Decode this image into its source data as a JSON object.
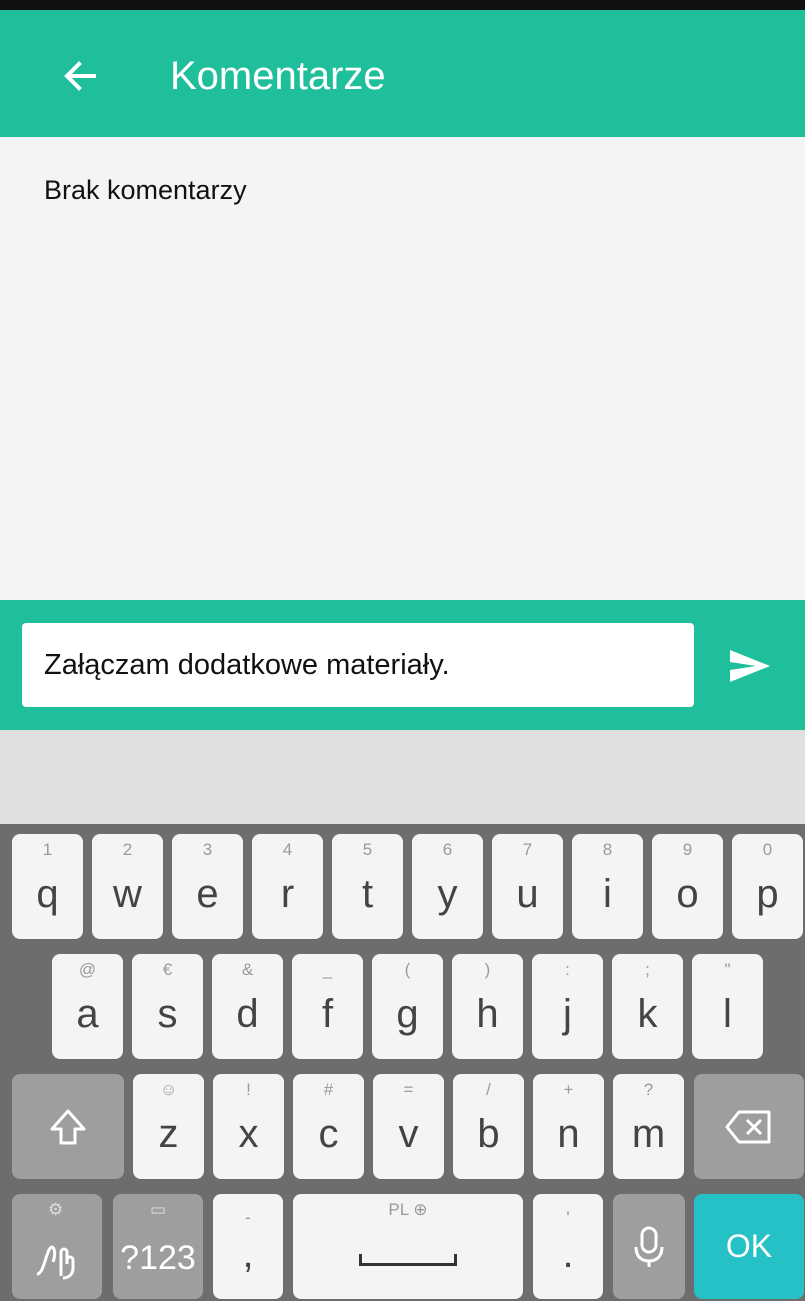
{
  "header": {
    "title": "Komentarze",
    "back_icon": "arrow-left-icon",
    "color": "#1fbf9b"
  },
  "comments": {
    "empty_text": "Brak komentarzy"
  },
  "composer": {
    "value": "Załączam dodatkowe materiały.",
    "send_icon": "send-icon"
  },
  "keyboard": {
    "row1": [
      {
        "hint": "1",
        "char": "q"
      },
      {
        "hint": "2",
        "char": "w"
      },
      {
        "hint": "3",
        "char": "e"
      },
      {
        "hint": "4",
        "char": "r"
      },
      {
        "hint": "5",
        "char": "t"
      },
      {
        "hint": "6",
        "char": "y"
      },
      {
        "hint": "7",
        "char": "u"
      },
      {
        "hint": "8",
        "char": "i"
      },
      {
        "hint": "9",
        "char": "o"
      },
      {
        "hint": "0",
        "char": "p"
      }
    ],
    "row2": [
      {
        "hint": "@",
        "char": "a"
      },
      {
        "hint": "€",
        "char": "s"
      },
      {
        "hint": "&",
        "char": "d"
      },
      {
        "hint": "_",
        "char": "f"
      },
      {
        "hint": "(",
        "char": "g"
      },
      {
        "hint": ")",
        "char": "h"
      },
      {
        "hint": ":",
        "char": "j"
      },
      {
        "hint": ";",
        "char": "k"
      },
      {
        "hint": "\"",
        "char": "l"
      }
    ],
    "row3": [
      {
        "hint": "☺",
        "char": "z"
      },
      {
        "hint": "!",
        "char": "x"
      },
      {
        "hint": "#",
        "char": "c"
      },
      {
        "hint": "=",
        "char": "v"
      },
      {
        "hint": "/",
        "char": "b"
      },
      {
        "hint": "+",
        "char": "n"
      },
      {
        "hint": "?",
        "char": "m"
      }
    ],
    "symbols_label": "?123",
    "comma": {
      "hint": "-",
      "char": ","
    },
    "space_label": "PL ⊕",
    "period": {
      "hint": "'",
      "char": "."
    },
    "ok_label": "OK",
    "ok_color": "#25c1c7"
  }
}
